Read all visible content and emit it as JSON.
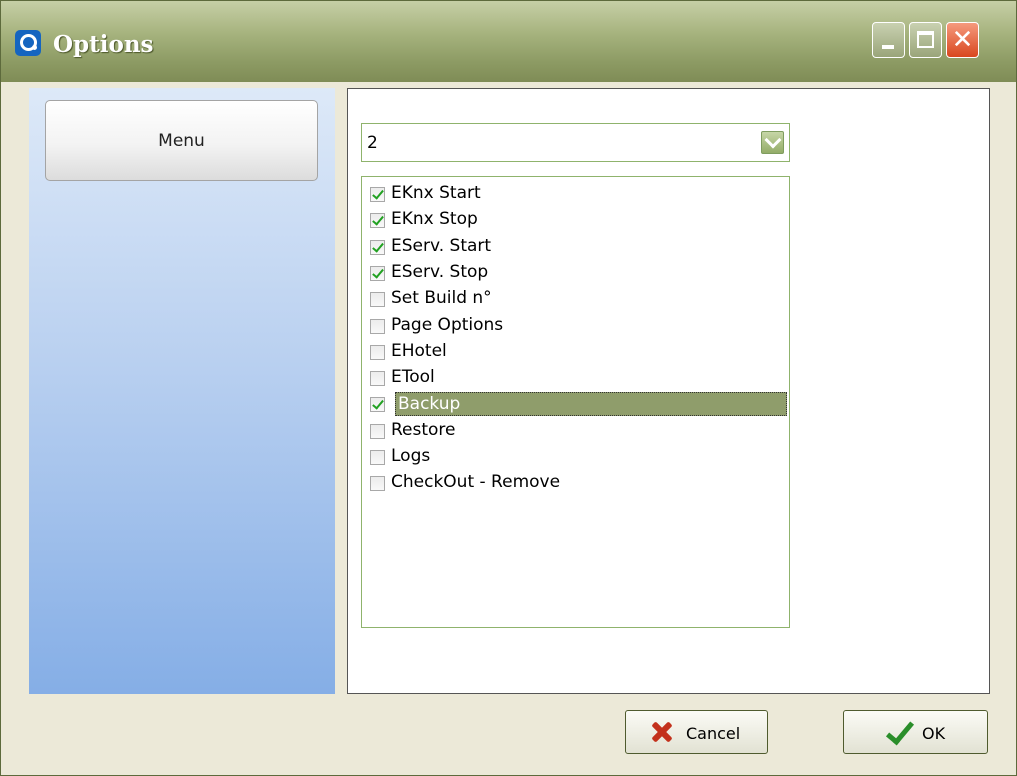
{
  "window": {
    "title": "Options"
  },
  "sidebar": {
    "menu_label": "Menu"
  },
  "combo": {
    "value": "2"
  },
  "list": {
    "items": [
      {
        "label": "EKnx Start",
        "checked": true
      },
      {
        "label": "EKnx Stop",
        "checked": true
      },
      {
        "label": "EServ. Start",
        "checked": true
      },
      {
        "label": "EServ. Stop",
        "checked": true
      },
      {
        "label": "Set Build n°",
        "checked": false
      },
      {
        "label": "Page Options",
        "checked": false
      },
      {
        "label": "EHotel",
        "checked": false
      },
      {
        "label": "ETool",
        "checked": false
      },
      {
        "label": "Backup",
        "checked": true,
        "selected": true
      },
      {
        "label": "Restore",
        "checked": false
      },
      {
        "label": "Logs",
        "checked": false
      },
      {
        "label": "CheckOut - Remove",
        "checked": false
      }
    ]
  },
  "buttons": {
    "cancel": "Cancel",
    "ok": "OK"
  },
  "colors": {
    "titlebar": "#8d9b64",
    "selection": "#8f9d6b",
    "check": "#21a121"
  }
}
